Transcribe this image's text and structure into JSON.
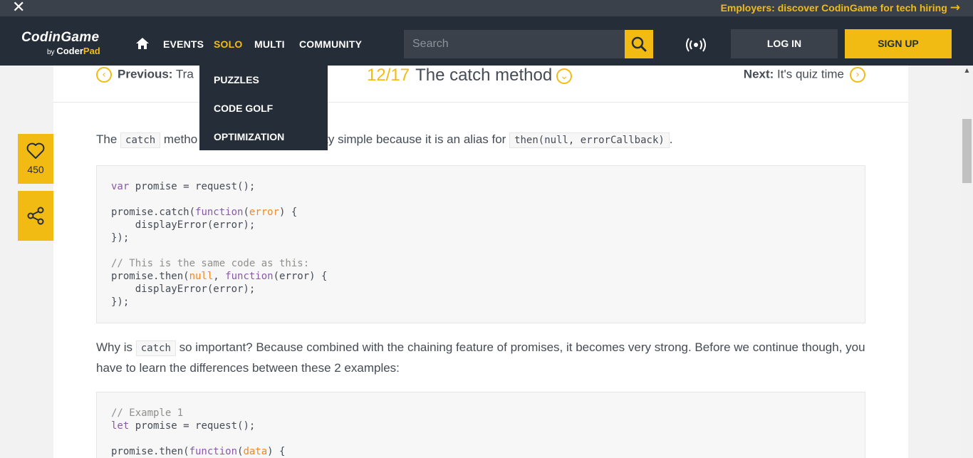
{
  "promo": {
    "close_icon": "close-icon",
    "text": "Employers: discover CodinGame for tech hiring",
    "arrow_icon": "arrow-right-icon"
  },
  "nav": {
    "logo_main": "CodinGame",
    "logo_by": "by",
    "logo_coder": "Coder",
    "logo_pad": "Pad",
    "home_icon": "home-icon",
    "links": [
      "EVENTS",
      "SOLO",
      "MULTI",
      "COMMUNITY"
    ],
    "active_link": "SOLO",
    "search_placeholder": "Search",
    "search_icon": "search-icon",
    "live_icon": "broadcast-icon",
    "login": "LOG IN",
    "signup": "SIGN UP"
  },
  "solo_menu": [
    "PUZZLES",
    "CODE GOLF",
    "OPTIMIZATION"
  ],
  "lesson": {
    "prev_label": "Previous:",
    "prev_title": "Tra",
    "step_num": "12/17",
    "title": "The catch method",
    "next_label": "Next:",
    "next_title": "It's quiz time"
  },
  "content": {
    "p1_before": "The",
    "p1_code1": "catch",
    "p1_mid_visible": "metho",
    "p1_after_visible": "ty simple because it is an alias for",
    "p1_code2": "then(null, errorCallback)",
    "p1_end": ".",
    "code1_lines": [
      "var promise = request();",
      "",
      "promise.catch(function(error) {",
      "    displayError(error);",
      "});",
      "",
      "// This is the same code as this:",
      "promise.then(null, function(error) {",
      "    displayError(error);",
      "});"
    ],
    "p2_before": "Why is",
    "p2_code": "catch",
    "p2_after": "so important? Because combined with the chaining feature of promises, it becomes very strong. Before we continue though, you have to learn the differences between these 2 examples:",
    "code2_lines": [
      "// Example 1",
      "let promise = request();",
      "",
      "promise.then(function(data) {"
    ]
  },
  "social": {
    "like_icon": "heart-icon",
    "like_count": "450",
    "share_icon": "share-icon"
  },
  "colors": {
    "accent": "#f2bb13",
    "nav_bg": "#252e38",
    "keyword": "#8959a8",
    "literal": "#f5871f",
    "comment": "#8e908c"
  }
}
